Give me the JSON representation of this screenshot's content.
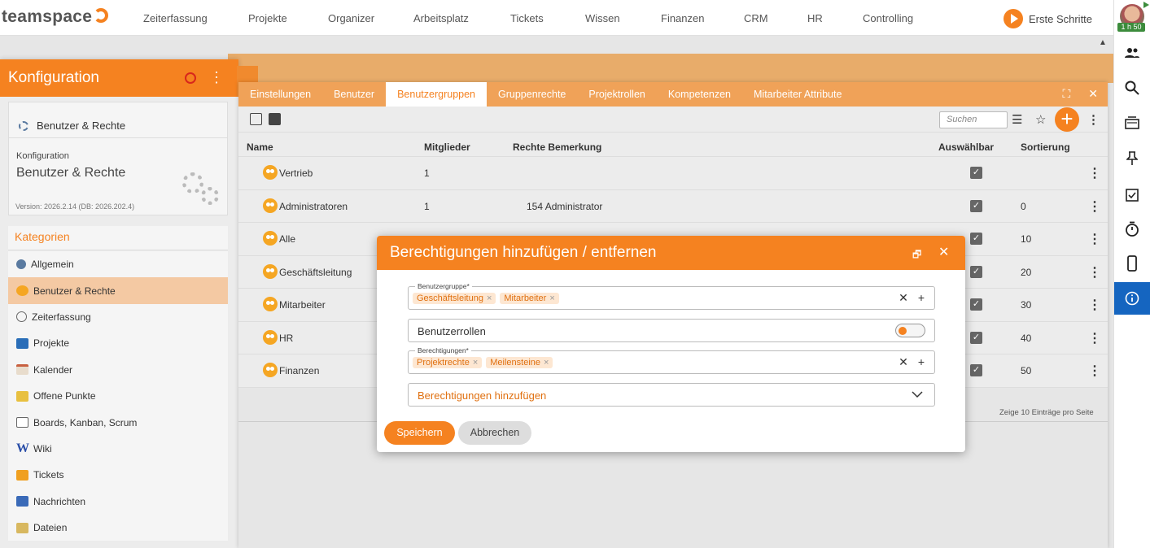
{
  "app": {
    "logo": "teamspace"
  },
  "topnav": [
    "Zeiterfassung",
    "Projekte",
    "Organizer",
    "Arbeitsplatz",
    "Tickets",
    "Wissen",
    "Finanzen",
    "CRM",
    "HR",
    "Controlling"
  ],
  "erste_schritte": "Erste Schritte",
  "user": {
    "time_badge": "1 h 50"
  },
  "konfig": {
    "title": "Konfiguration",
    "section": "Benutzer & Rechte",
    "small_label": "Konfiguration",
    "big_label": "Benutzer & Rechte",
    "version": "Version: 2026.2.14 (DB: 2026.202.4)",
    "kategorien_title": "Kategorien",
    "kategorien": [
      {
        "label": "Allgemein",
        "color": "#5a7aa0"
      },
      {
        "label": "Benutzer & Rechte",
        "color": "#f5a623"
      },
      {
        "label": "Zeiterfassung",
        "color": "#666"
      },
      {
        "label": "Projekte",
        "color": "#2a6eb8"
      },
      {
        "label": "Kalender",
        "color": "#c8a070"
      },
      {
        "label": "Offene Punkte",
        "color": "#e8c040"
      },
      {
        "label": "Boards, Kanban, Scrum",
        "color": "#5a9a5a"
      },
      {
        "label": "Wiki",
        "color": "#2a4ea8"
      },
      {
        "label": "Tickets",
        "color": "#f0a020"
      },
      {
        "label": "Nachrichten",
        "color": "#3a6ab8"
      },
      {
        "label": "Dateien",
        "color": "#d8b860"
      }
    ]
  },
  "tabs": [
    "Einstellungen",
    "Benutzer",
    "Benutzergruppen",
    "Gruppenrechte",
    "Projektrollen",
    "Kompetenzen",
    "Mitarbeiter Attribute"
  ],
  "active_tab": "Benutzergruppen",
  "search_placeholder": "Suchen",
  "table": {
    "headers": {
      "name": "Name",
      "mitglieder": "Mitglieder",
      "bemerkung": "Rechte Bemerkung",
      "auswaehlbar": "Auswählbar",
      "sortierung": "Sortierung"
    },
    "rows": [
      {
        "name": "Vertrieb",
        "mitglieder": "1",
        "bemerkung": "",
        "sortierung": ""
      },
      {
        "name": "Administratoren",
        "mitglieder": "1",
        "bemerkung": "154 Administrator",
        "sortierung": "0"
      },
      {
        "name": "Alle",
        "mitglieder": "",
        "bemerkung": "",
        "sortierung": "10"
      },
      {
        "name": "Geschäftsleitung",
        "mitglieder": "",
        "bemerkung": "",
        "sortierung": "20"
      },
      {
        "name": "Mitarbeiter",
        "mitglieder": "",
        "bemerkung": "",
        "sortierung": "30"
      },
      {
        "name": "HR",
        "mitglieder": "",
        "bemerkung": "",
        "sortierung": "40"
      },
      {
        "name": "Finanzen",
        "mitglieder": "",
        "bemerkung": "",
        "sortierung": "50"
      }
    ],
    "footer": "Zeige  10  Einträge pro Seite"
  },
  "modal": {
    "title": "Berechtigungen hinzufügen / entfernen",
    "benutzergruppe_label": "Benutzergruppe*",
    "benutzergruppe_chips": [
      "Geschäftsleitung",
      "Mitarbeiter"
    ],
    "benutzerrollen_label": "Benutzerrollen",
    "berechtigungen_label": "Berechtigungen*",
    "berechtigungen_chips": [
      "Projektrechte",
      "Meilensteine"
    ],
    "action_select": "Berechtigungen hinzufügen",
    "save": "Speichern",
    "cancel": "Abbrechen"
  }
}
